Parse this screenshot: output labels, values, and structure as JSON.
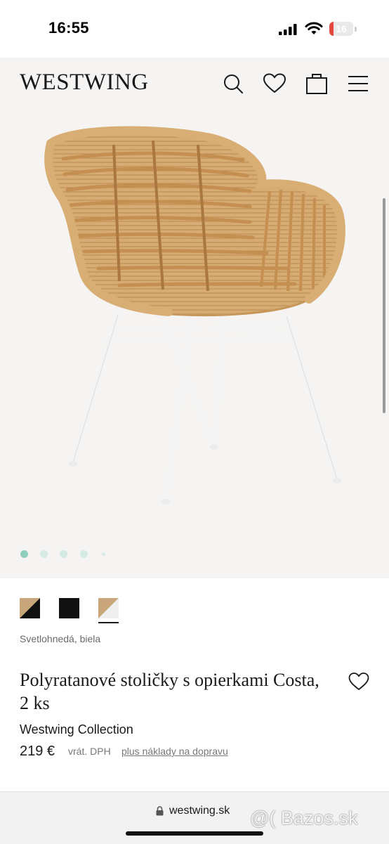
{
  "status_bar": {
    "time": "16:55",
    "battery_level": "16",
    "battery_color": "#e5483c"
  },
  "header": {
    "logo": "WESTWING",
    "icons": [
      "search-icon",
      "heart-icon",
      "bag-icon",
      "menu-icon"
    ]
  },
  "gallery": {
    "image": "rattan-chair-photo",
    "slide_count": 5,
    "active_slide": 1,
    "dot_active_color": "#8fcdbc",
    "dot_inactive_color": "#d4ebe5"
  },
  "product": {
    "swatches": [
      {
        "name": "svetlohneda-cierna",
        "colors": [
          "#c8a57a",
          "#111111"
        ]
      },
      {
        "name": "cierna",
        "colors": [
          "#111111"
        ]
      },
      {
        "name": "svetlohneda-biela",
        "colors": [
          "#c8a57a",
          "#f2f2f2"
        ],
        "selected": true
      }
    ],
    "color_name": "Svetlohnedá, biela",
    "title": "Polyratanové stoličky s opierkami Costa, 2 ks",
    "brand": "Westwing Collection",
    "price": "219 €",
    "vat_note": "vrát. DPH",
    "shipping_link": "plus náklady na dopravu"
  },
  "browser": {
    "url": "westwing.sk",
    "watermark": "@( Bazos.sk"
  }
}
